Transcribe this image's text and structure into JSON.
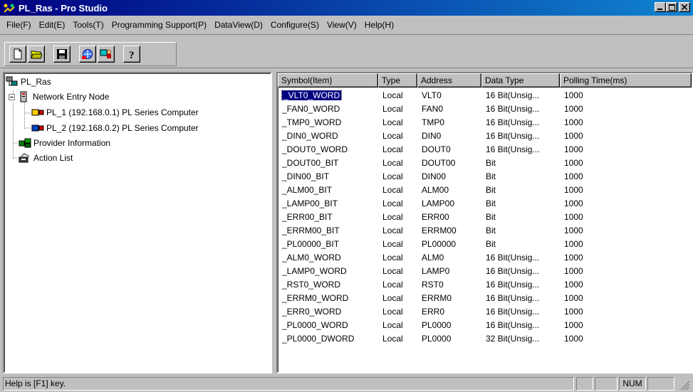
{
  "window": {
    "title": "PL_Ras - Pro Studio"
  },
  "menubar": [
    {
      "label": "File(F)"
    },
    {
      "label": "Edit(E)"
    },
    {
      "label": "Tools(T)"
    },
    {
      "label": "Programming Support(P)"
    },
    {
      "label": "DataView(D)"
    },
    {
      "label": "Configure(S)"
    },
    {
      "label": "View(V)"
    },
    {
      "label": "Help(H)"
    }
  ],
  "toolbar": {
    "buttons": [
      {
        "icon": "new-document-icon"
      },
      {
        "icon": "open-folder-icon"
      },
      {
        "icon": "save-disk-icon"
      },
      {
        "icon": "network-globe-icon"
      },
      {
        "icon": "monitor-people-icon"
      },
      {
        "icon": "help-question-icon"
      }
    ]
  },
  "tree": {
    "root": "PL_Ras",
    "network_entry": "Network Entry Node",
    "pl1": "PL_1 (192.168.0.1) PL Series Computer",
    "pl2": "PL_2 (192.168.0.2) PL Series Computer",
    "provider": "Provider Information",
    "action": "Action List"
  },
  "table": {
    "columns": [
      "Symbol(Item)",
      "Type",
      "Address",
      "Data Type",
      "Polling Time(ms)"
    ],
    "rows": [
      [
        "_VLT0_WORD",
        "Local",
        "VLT0",
        "16 Bit(Unsig...",
        "1000"
      ],
      [
        "_FAN0_WORD",
        "Local",
        "FAN0",
        "16 Bit(Unsig...",
        "1000"
      ],
      [
        "_TMP0_WORD",
        "Local",
        "TMP0",
        "16 Bit(Unsig...",
        "1000"
      ],
      [
        "_DIN0_WORD",
        "Local",
        "DIN0",
        "16 Bit(Unsig...",
        "1000"
      ],
      [
        "_DOUT0_WORD",
        "Local",
        "DOUT0",
        "16 Bit(Unsig...",
        "1000"
      ],
      [
        "_DOUT00_BIT",
        "Local",
        "DOUT00",
        "Bit",
        "1000"
      ],
      [
        "_DIN00_BIT",
        "Local",
        "DIN00",
        "Bit",
        "1000"
      ],
      [
        "_ALM00_BIT",
        "Local",
        "ALM00",
        "Bit",
        "1000"
      ],
      [
        "_LAMP00_BIT",
        "Local",
        "LAMP00",
        "Bit",
        "1000"
      ],
      [
        "_ERR00_BIT",
        "Local",
        "ERR00",
        "Bit",
        "1000"
      ],
      [
        "_ERRM00_BIT",
        "Local",
        "ERRM00",
        "Bit",
        "1000"
      ],
      [
        "_PL00000_BIT",
        "Local",
        "PL00000",
        "Bit",
        "1000"
      ],
      [
        "_ALM0_WORD",
        "Local",
        "ALM0",
        "16 Bit(Unsig...",
        "1000"
      ],
      [
        "_LAMP0_WORD",
        "Local",
        "LAMP0",
        "16 Bit(Unsig...",
        "1000"
      ],
      [
        "_RST0_WORD",
        "Local",
        "RST0",
        "16 Bit(Unsig...",
        "1000"
      ],
      [
        "_ERRM0_WORD",
        "Local",
        "ERRM0",
        "16 Bit(Unsig...",
        "1000"
      ],
      [
        "_ERR0_WORD",
        "Local",
        "ERR0",
        "16 Bit(Unsig...",
        "1000"
      ],
      [
        "_PL0000_WORD",
        "Local",
        "PL0000",
        "16 Bit(Unsig...",
        "1000"
      ],
      [
        "_PL0000_DWORD",
        "Local",
        "PL0000",
        "32 Bit(Unsig...",
        "1000"
      ]
    ]
  },
  "statusbar": {
    "help_text": "Help is [F1] key.",
    "num": "NUM"
  },
  "colors": {
    "title_start": "#000080",
    "title_end": "#1084d0",
    "selection": "#000080",
    "face": "#c0c0c0"
  }
}
